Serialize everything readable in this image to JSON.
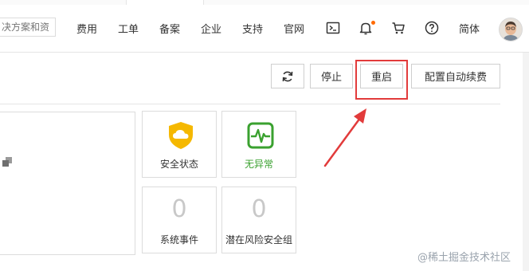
{
  "header": {
    "search_placeholder": "决方案和资",
    "nav": [
      "费用",
      "工单",
      "备案",
      "企业",
      "支持",
      "官网"
    ],
    "language": "简体",
    "icons": [
      "terminal-icon",
      "bell-icon",
      "cart-icon",
      "help-icon"
    ],
    "bell_badge_color": "#ff6a00"
  },
  "actions": {
    "refresh_icon": "refresh-icon",
    "stop_label": "停止",
    "restart_label": "重启",
    "auto_renew_label": "配置自动续费",
    "highlight_color": "#e23b3b"
  },
  "tiles": {
    "security_status": {
      "label": "安全状态",
      "icon": "shield-cloud-icon",
      "color": "#f5b800"
    },
    "health": {
      "label": "无异常",
      "icon": "heartbeat-monitor-icon",
      "color": "#3aa12f"
    },
    "system_events": {
      "count": "0",
      "label": "系统事件"
    },
    "risk_security_groups": {
      "count": "0",
      "label": "潜在风险安全组"
    }
  },
  "watermark": "@稀土掘金技术社区"
}
